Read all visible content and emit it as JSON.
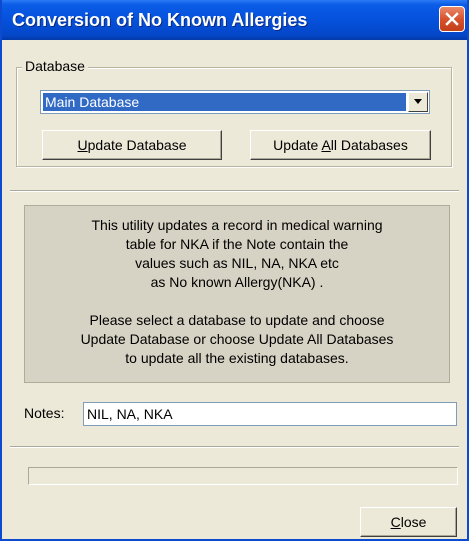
{
  "window": {
    "title": "Conversion of No Known Allergies",
    "close_icon": "close-icon"
  },
  "database_group": {
    "legend": "Database",
    "selected": "Main Database",
    "dropdown_icon": "chevron-down-icon"
  },
  "buttons": {
    "update_database": {
      "mnemonic": "U",
      "rest": "pdate Database"
    },
    "update_all": {
      "before": "Update ",
      "mnemonic": "A",
      "after": "ll Databases"
    },
    "close": {
      "mnemonic": "C",
      "rest": "lose"
    }
  },
  "info": {
    "lines": [
      "This utility updates a record in medical warning",
      "table for NKA if the Note contain the",
      "values such as  NIL, NA, NKA etc",
      "as No known Allergy(NKA) .",
      "",
      "Please select a database to update and choose",
      "Update Database or choose  Update All Databases",
      "to update  all the existing  databases."
    ]
  },
  "notes": {
    "label": "Notes:",
    "value": "NIL, NA, NKA"
  },
  "progress": {
    "fraction": 0
  },
  "colors": {
    "titlebar": "#0551dc",
    "selection": "#316ac5",
    "face": "#ece9d8",
    "info_panel": "#d6d2c4"
  }
}
